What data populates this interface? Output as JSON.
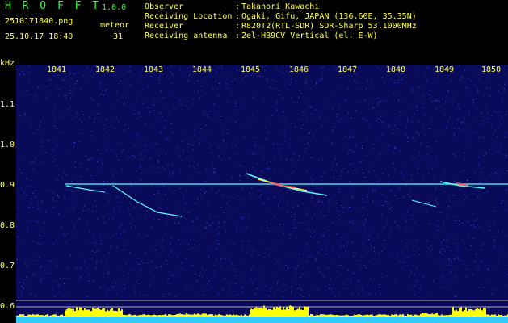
{
  "header": {
    "app_name": "H R O F F T",
    "version": "1.0.0",
    "filename": "2510171840.png",
    "datetime": "25.10.17 18:40",
    "meteor_label": "meteor",
    "meteor_count": "31"
  },
  "info": [
    {
      "label": "Observer",
      "value": "Takanori Kawachi"
    },
    {
      "label": "Receiving Location",
      "value": "Ogaki, Gifu, JAPAN (136.60E, 35.35N)"
    },
    {
      "label": "Receiver",
      "value": "R820T2(RTL-SDR) SDR-Sharp 53.1000MHz"
    },
    {
      "label": "Receiving antenna",
      "value": "2el-HB9CV Vertical (el. E-W)"
    }
  ],
  "axes": {
    "unit": "kHz",
    "y_ticks": [
      "1.1",
      "1.0",
      "0.9",
      "0.8",
      "0.7",
      "0.6"
    ],
    "x_ticks": [
      "1841",
      "1842",
      "1843",
      "1844",
      "1845",
      "1846",
      "1847",
      "1848",
      "1849",
      "1850"
    ]
  },
  "colors": {
    "background": "#0a0a5a",
    "carrier": "#55ffff",
    "label_text": "#ffff55",
    "title_text": "#33ff33",
    "meteor_count_bars": "#ffff00",
    "noise_floor": "#55ffff"
  }
}
